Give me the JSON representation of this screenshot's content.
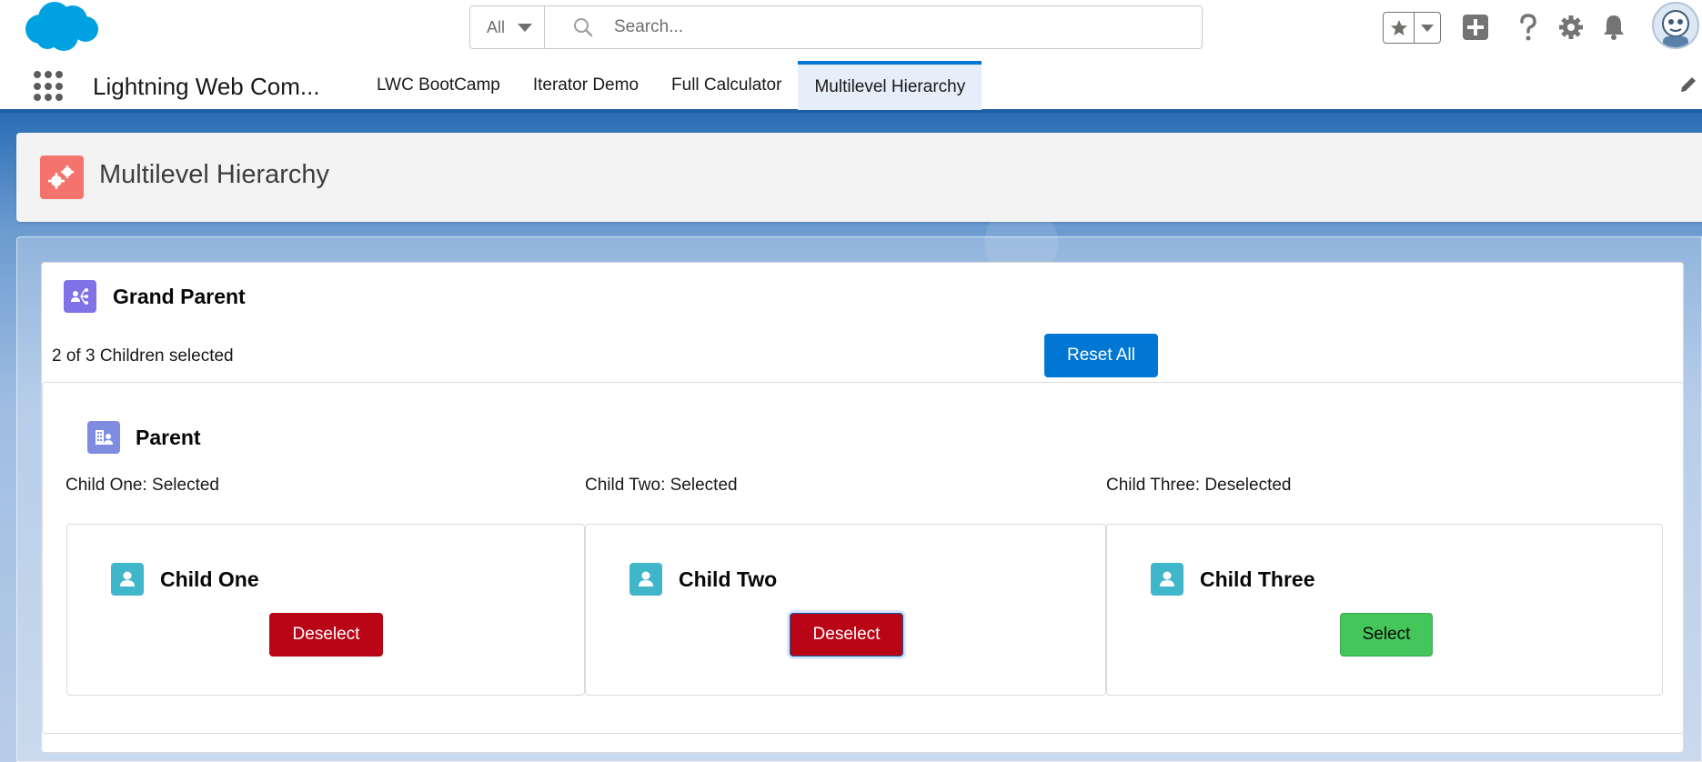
{
  "header": {
    "search_scope": "All",
    "search_placeholder": "Search..."
  },
  "nav": {
    "app_name": "Lightning Web Com...",
    "tabs": [
      {
        "label": "LWC BootCamp",
        "active": false
      },
      {
        "label": "Iterator Demo",
        "active": false
      },
      {
        "label": "Full Calculator",
        "active": false
      },
      {
        "label": "Multilevel Hierarchy",
        "active": true
      }
    ]
  },
  "page": {
    "title": "Multilevel Hierarchy"
  },
  "grand_parent": {
    "title": "Grand Parent",
    "selected_summary": "2 of 3 Children selected",
    "reset_label": "Reset All"
  },
  "parent": {
    "title": "Parent",
    "statuses": [
      "Child One: Selected",
      "Child Two: Selected",
      "Child Three: Deselected"
    ],
    "children": [
      {
        "name": "Child One",
        "button_label": "Deselect",
        "selected": true
      },
      {
        "name": "Child Two",
        "button_label": "Deselect",
        "selected": true
      },
      {
        "name": "Child Three",
        "button_label": "Select",
        "selected": false
      }
    ]
  },
  "colors": {
    "brand": "#0176d3",
    "deselect": "#ba0517",
    "select": "#45c65a",
    "page_icon": "#f4736c",
    "grand_parent_icon": "#7f72e6",
    "parent_icon": "#7f8de1",
    "child_icon": "#3fb6c9"
  }
}
